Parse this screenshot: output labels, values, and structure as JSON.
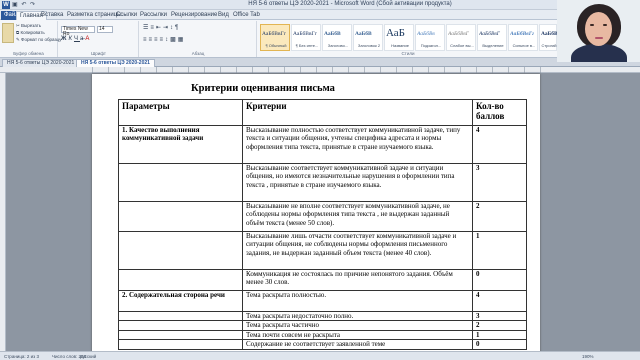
{
  "window": {
    "title": "НЯ 5-6 ответы ЦЭ 2020-2021  -  Microsoft Word (Сбой активации продукта)",
    "qat_icons": [
      "save-icon",
      "undo-icon",
      "redo-icon"
    ],
    "app_icon_letter": "W"
  },
  "menu": {
    "tabs": [
      "Файл",
      "Главная",
      "Вставка",
      "Разметка страницы",
      "Ссылки",
      "Рассылки",
      "Рецензирование",
      "Вид",
      "Office Tab"
    ],
    "active_tab": "Главная"
  },
  "ribbon": {
    "clipboard": {
      "cut": "Вырезать",
      "copy": "Копировать",
      "format_painter": "Формат по образцу",
      "label": "Буфер обмена"
    },
    "font": {
      "name": "Times New Ro",
      "size": "14",
      "label": "Шрифт"
    },
    "paragraph": {
      "label": "Абзац"
    },
    "styles": {
      "label": "Стили",
      "items": [
        {
          "sample": "АаБбВвГг",
          "name": "¶ Обычный"
        },
        {
          "sample": "АаБбВвГг",
          "name": "¶ Без инте..."
        },
        {
          "sample": "АаБбВ",
          "name": "Заголово..."
        },
        {
          "sample": "АаБбВ",
          "name": "Заголовок 2"
        },
        {
          "sample": "АаБ",
          "name": "Название"
        },
        {
          "sample": "АаБбВв",
          "name": "Подзагол..."
        },
        {
          "sample": "АаБбВвГ",
          "name": "Слабое вы..."
        },
        {
          "sample": "АаБбВвГ",
          "name": "Выделение"
        },
        {
          "sample": "АаБбВвГг",
          "name": "Сильное в..."
        },
        {
          "sample": "АаБбВвГг",
          "name": "Строгий"
        }
      ]
    }
  },
  "doc_tabs": [
    "НЯ 5-6 ответы ЦЭ  2020-2021",
    "НЯ 5-6 ответы ЦЭ 2020-2021"
  ],
  "document": {
    "title": "Критерии оценивания  письма",
    "headers": [
      "Параметры",
      "Критерии",
      "Кол-во баллов"
    ],
    "rows": [
      {
        "param": "1. Качество выполнения коммуникативной задачи",
        "criterion": "Высказывание полностью соответствует коммуникативной задаче, типу текста и ситуации общения, учтены специфика адресата и нормы оформления типа текста, принятые в стране изучаемого языка.",
        "score": "4"
      },
      {
        "param": "",
        "criterion": "Высказывание соответствует коммуникативной задаче и ситуации общения, но имеются незначительные нарушения в оформлении типа текста , принятые в стране изучаемого языка.",
        "score": "3"
      },
      {
        "param": "",
        "criterion": "Высказывание не вполне соответствует коммуникативной задаче, не соблюдены нормы оформления типа текста , не выдержан заданный объём текста (менее 50 слов).",
        "score": "2"
      },
      {
        "param": "",
        "criterion": "Высказывание лишь отчасти соответствует коммуникативной задаче и ситуации общения, не соблюдены нормы оформления письменного задания, не выдержан заданный объем текста (менее 40 слов).",
        "score": "1"
      },
      {
        "param": "",
        "criterion": "Коммуникация не состоялась по причине непонятого задания. Объём менее 30 слов.",
        "score": "0"
      },
      {
        "param": "2. Содержательная сторона речи",
        "criterion": "Тема раскрыта полностью.",
        "score": "4"
      },
      {
        "param": "",
        "criterion": "Тема раскрыта недостаточно полно.",
        "score": "3"
      },
      {
        "param": "",
        "criterion": "Тема раскрыта частично",
        "score": "2"
      },
      {
        "param": "",
        "criterion": "Тема почти совсем не раскрыта",
        "score": "1"
      },
      {
        "param": "",
        "criterion": "Содержание не соответствует заявленной теме",
        "score": "0"
      }
    ]
  },
  "status": {
    "page": "Страница: 2 из 3",
    "words": "Число слов: 203",
    "language": "русский",
    "zoom": "190%"
  }
}
